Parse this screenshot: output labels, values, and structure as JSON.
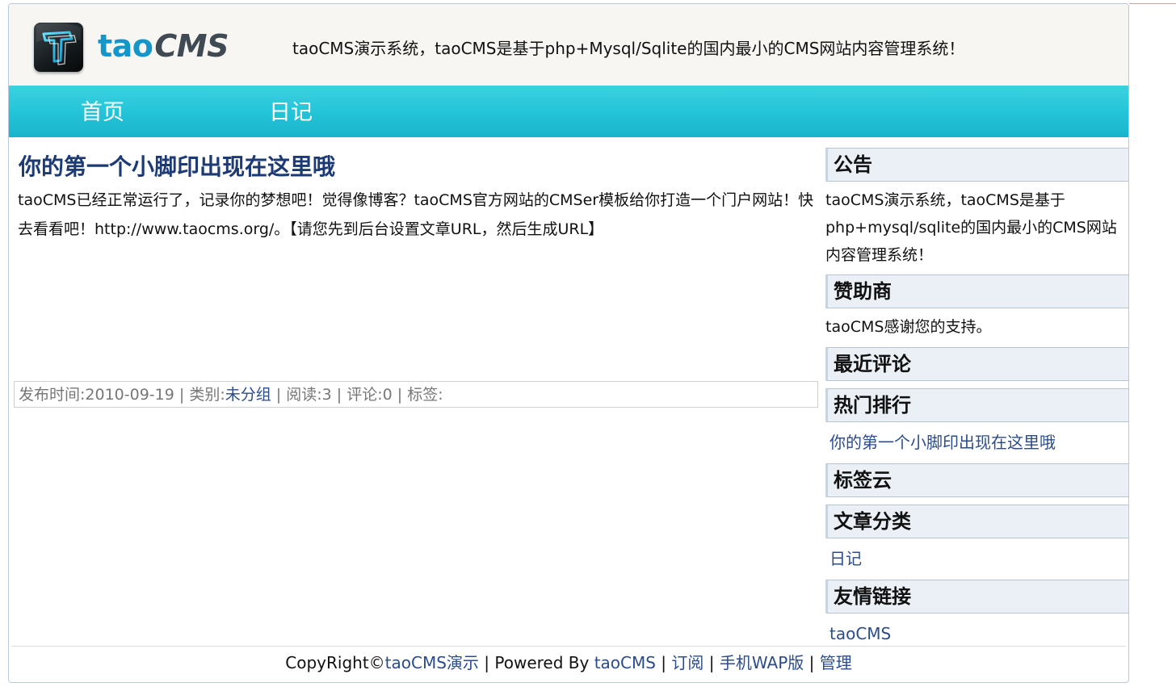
{
  "header": {
    "logo_tao": "tao",
    "logo_cms": "CMS",
    "slogan": "taoCMS演示系统，taoCMS是基于php+Mysql/Sqlite的国内最小的CMS网站内容管理系统！"
  },
  "nav": {
    "items": [
      {
        "label": "首页"
      },
      {
        "label": "日记"
      }
    ]
  },
  "post": {
    "title": "你的第一个小脚印出现在这里哦",
    "body": "taoCMS已经正常运行了，记录你的梦想吧！觉得像博客？taoCMS官方网站的CMSer模板给你打造一个门户网站！快去看看吧！http://www.taocms.org/。【请您先到后台设置文章URL，然后生成URL】",
    "meta": {
      "published_label": "发布时间:",
      "published_value": "2010-09-19",
      "category_label": "类别:",
      "category_value": "未分组",
      "reads_label": "阅读:",
      "reads_value": "3",
      "comments_label": "评论:",
      "comments_value": "0",
      "tags_label": "标签:",
      "sep": " | "
    }
  },
  "sidebar": {
    "notice_title": "公告",
    "notice_text": "taoCMS演示系统，taoCMS是基于php+mysql/sqlite的国内最小的CMS网站内容管理系统！",
    "sponsor_title": "赞助商",
    "sponsor_text": "taoCMS感谢您的支持。",
    "recent_comments_title": "最近评论",
    "hot_title": "热门排行",
    "hot_items": [
      "你的第一个小脚印出现在这里哦"
    ],
    "tags_title": "标签云",
    "categories_title": "文章分类",
    "category_items": [
      "日记"
    ],
    "links_title": "友情链接",
    "link_items": [
      "taoCMS"
    ]
  },
  "footer": {
    "copyright_prefix": "CopyRight©",
    "site_link": "taoCMS演示",
    "powered_prefix": " | Powered By ",
    "powered_link": "taoCMS",
    "sep": " | ",
    "subscribe": "订阅",
    "wap": "手机WAP版",
    "admin": "管理"
  }
}
